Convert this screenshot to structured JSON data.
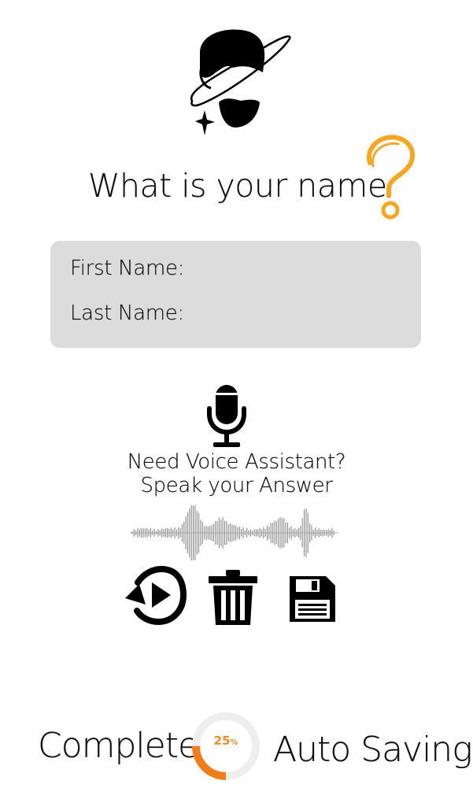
{
  "question": {
    "text": "What is your name",
    "mark_color": "#f5a623"
  },
  "form": {
    "first_name_label": "First Name:",
    "last_name_label": "Last Name:",
    "first_name_value": "",
    "last_name_value": "",
    "card_color": "#dcdcdc"
  },
  "voice": {
    "line1": "Need Voice Assistant?",
    "line2": "Speak your Answer",
    "mic_icon": "microphone-icon"
  },
  "actions": [
    {
      "name": "replay",
      "icon": "replay-icon"
    },
    {
      "name": "delete",
      "icon": "trash-icon"
    },
    {
      "name": "save",
      "icon": "floppy-disk-icon"
    }
  ],
  "footer": {
    "complete_label": "Complete",
    "progress_value": "25",
    "progress_unit": "%",
    "progress_fraction": 0.25,
    "progress_color": "#f07c1a",
    "track_color": "#eeeeee",
    "autosave_label": "Auto Saving"
  }
}
